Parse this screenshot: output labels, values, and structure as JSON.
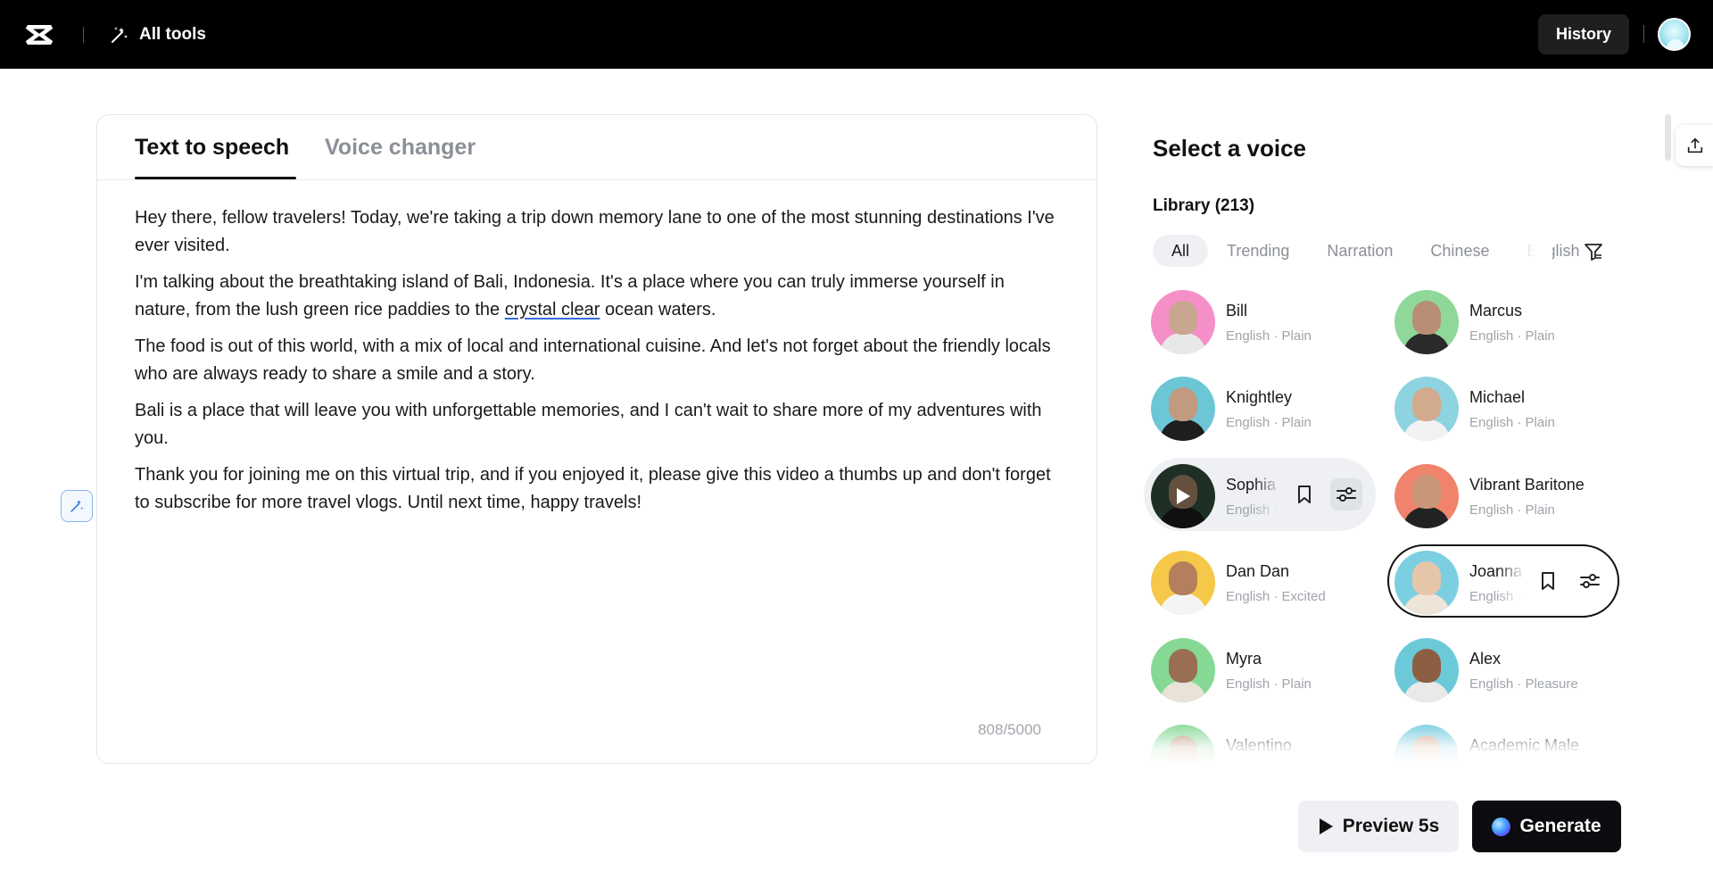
{
  "topbar": {
    "all_tools_label": "All tools",
    "history_label": "History"
  },
  "editor": {
    "tabs": [
      {
        "label": "Text to speech",
        "active": true
      },
      {
        "label": "Voice changer",
        "active": false
      }
    ],
    "paragraphs": [
      "Hey there, fellow travelers! Today, we're taking a trip down memory lane to one of the most stunning destinations I've ever visited.",
      "I'm talking about the breathtaking island of Bali, Indonesia. It's a place where you can truly immerse yourself in nature, from the lush green rice paddies to the ",
      "crystal clear",
      " ocean waters.",
      "The food is out of this world, with a mix of local and international cuisine. And let's not forget about the friendly locals who are always ready to share a smile and a story.",
      "Bali is a place that will leave you with unforgettable memories, and I can't wait to share more of my adventures with you.",
      "Thank you for joining me on this virtual trip, and if you enjoyed it, please give this video a thumbs up and don't forget to subscribe for more travel vlogs. Until next time, happy travels!"
    ],
    "char_count": "808/5000"
  },
  "voice_panel": {
    "title": "Select a voice",
    "library_label": "Library (213)",
    "filters": [
      "All",
      "Trending",
      "Narration",
      "Chinese",
      "English"
    ],
    "active_filter": "All",
    "voices": [
      {
        "name": "Bill",
        "meta": "English · Plain",
        "bg": "#f48fc7",
        "skin": "#c9a68f",
        "shirt": "#e8e8e8"
      },
      {
        "name": "Marcus",
        "meta": "English · Plain",
        "bg": "#8fd89a",
        "skin": "#b88f74",
        "shirt": "#2a2a2a"
      },
      {
        "name": "Knightley",
        "meta": "English · Plain",
        "bg": "#6cc6d6",
        "skin": "#c19a80",
        "shirt": "#1e1e1e"
      },
      {
        "name": "Michael",
        "meta": "English · Plain",
        "bg": "#8ed3e0",
        "skin": "#d2aa8e",
        "shirt": "#f2f2f2"
      },
      {
        "name": "Sophia",
        "meta": "English · Plain",
        "bg": "#2f4a3a",
        "skin": "#9c7b63",
        "shirt": "#1a1a1a",
        "state": "hover"
      },
      {
        "name": "Vibrant Baritone",
        "meta": "English · Plain",
        "bg": "#f0836c",
        "skin": "#c8977a",
        "shirt": "#222"
      },
      {
        "name": "Dan Dan",
        "meta": "English · Excited",
        "bg": "#f6c84a",
        "skin": "#b47f5c",
        "shirt": "#f4f4f4"
      },
      {
        "name": "Joanna",
        "meta": "English · Plain",
        "bg": "#7ccfe0",
        "skin": "#e6c6a9",
        "shirt": "#efe4d8",
        "state": "selected"
      },
      {
        "name": "Myra",
        "meta": "English · Plain",
        "bg": "#86d994",
        "skin": "#9a6e52",
        "shirt": "#e8e2d8"
      },
      {
        "name": "Alex",
        "meta": "English · Pleasure",
        "bg": "#6cc9d8",
        "skin": "#8c5f42",
        "shirt": "#e9e9e9"
      },
      {
        "name": "Valentino",
        "meta": "",
        "bg": "#8ad89a",
        "skin": "#b89278",
        "shirt": "#333"
      },
      {
        "name": "Academic Male",
        "meta": "",
        "bg": "#7ccfe0",
        "skin": "#cfa98c",
        "shirt": "#ddd"
      }
    ]
  },
  "actions": {
    "preview_label": "Preview 5s",
    "generate_label": "Generate"
  }
}
